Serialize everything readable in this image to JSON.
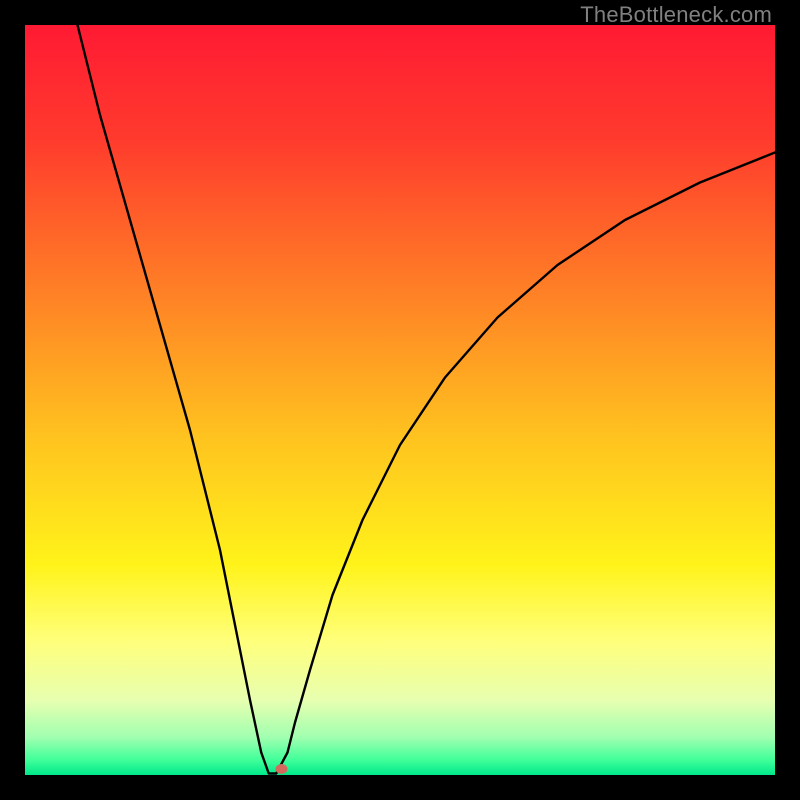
{
  "watermark": "TheBottleneck.com",
  "chart_data": {
    "type": "line",
    "title": "",
    "xlabel": "",
    "ylabel": "",
    "xlim": [
      0,
      100
    ],
    "ylim": [
      0,
      100
    ],
    "background_gradient": {
      "stops": [
        {
          "offset": 0.0,
          "color": "#ff1a33"
        },
        {
          "offset": 0.15,
          "color": "#ff3a2d"
        },
        {
          "offset": 0.35,
          "color": "#ff7e26"
        },
        {
          "offset": 0.55,
          "color": "#ffc31f"
        },
        {
          "offset": 0.72,
          "color": "#fff31a"
        },
        {
          "offset": 0.82,
          "color": "#ffff7a"
        },
        {
          "offset": 0.9,
          "color": "#e8ffb0"
        },
        {
          "offset": 0.95,
          "color": "#a0ffb0"
        },
        {
          "offset": 0.98,
          "color": "#40ff9a"
        },
        {
          "offset": 1.0,
          "color": "#00e88a"
        }
      ]
    },
    "curve": {
      "x": [
        7.0,
        10,
        14,
        18,
        22,
        26,
        28,
        30,
        31.5,
        32.5,
        33.5,
        35.0,
        36.0,
        38,
        41,
        45,
        50,
        56,
        63,
        71,
        80,
        90,
        100
      ],
      "y": [
        100,
        88,
        74,
        60,
        46,
        30,
        20,
        10,
        3.0,
        0.2,
        0.2,
        3.0,
        7.0,
        14,
        24,
        34,
        44,
        53,
        61,
        68,
        74,
        79,
        83
      ],
      "stroke": "#000000",
      "stroke_width": 2.4
    },
    "marker": {
      "x": 34.2,
      "y": 0.8,
      "rx": 6,
      "ry": 5,
      "fill": "#d46a5d"
    }
  }
}
